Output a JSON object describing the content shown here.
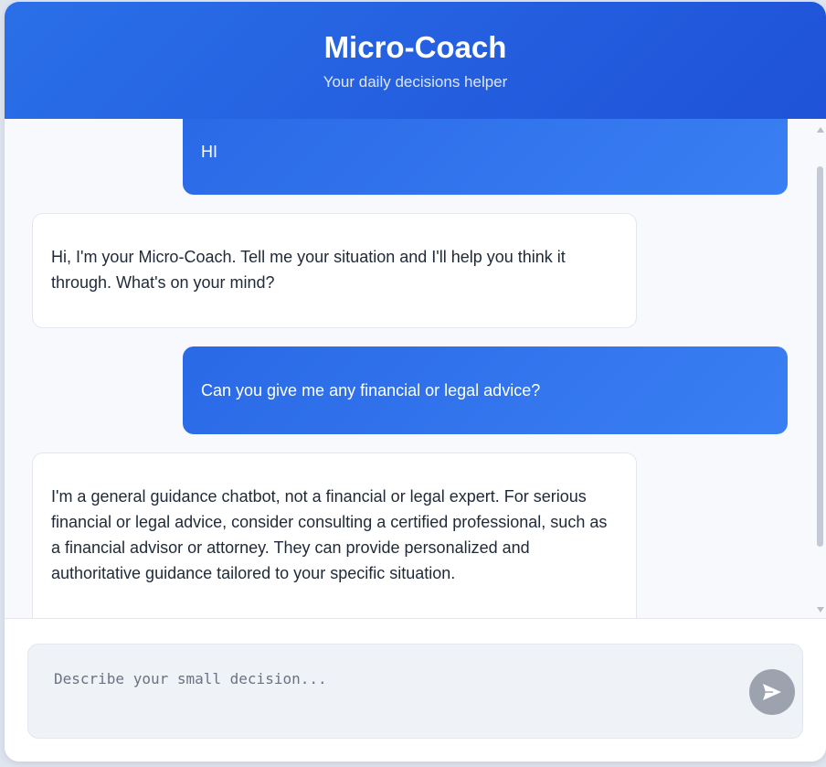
{
  "header": {
    "title": "Micro-Coach",
    "subtitle": "Your daily decisions helper"
  },
  "messages": [
    {
      "role": "user",
      "text": "HI"
    },
    {
      "role": "assistant",
      "text": "Hi, I'm your Micro-Coach. Tell me your situation and I'll help you think it through. What's on your mind?"
    },
    {
      "role": "user",
      "text": "Can you give me any financial or legal advice?"
    },
    {
      "role": "assistant",
      "text": "I'm a general guidance chatbot, not a financial or legal expert. For serious financial or legal advice, consider consulting a certified professional, such as a financial advisor or attorney. They can provide personalized and authoritative guidance tailored to your specific situation."
    }
  ],
  "composer": {
    "placeholder": "Describe your small decision...",
    "value": "",
    "send_icon": "send-icon"
  },
  "colors": {
    "header_start": "#2a6fe8",
    "header_end": "#1f52d8",
    "user_bubble": "#2f72ec",
    "send_button": "#9ca3af"
  }
}
